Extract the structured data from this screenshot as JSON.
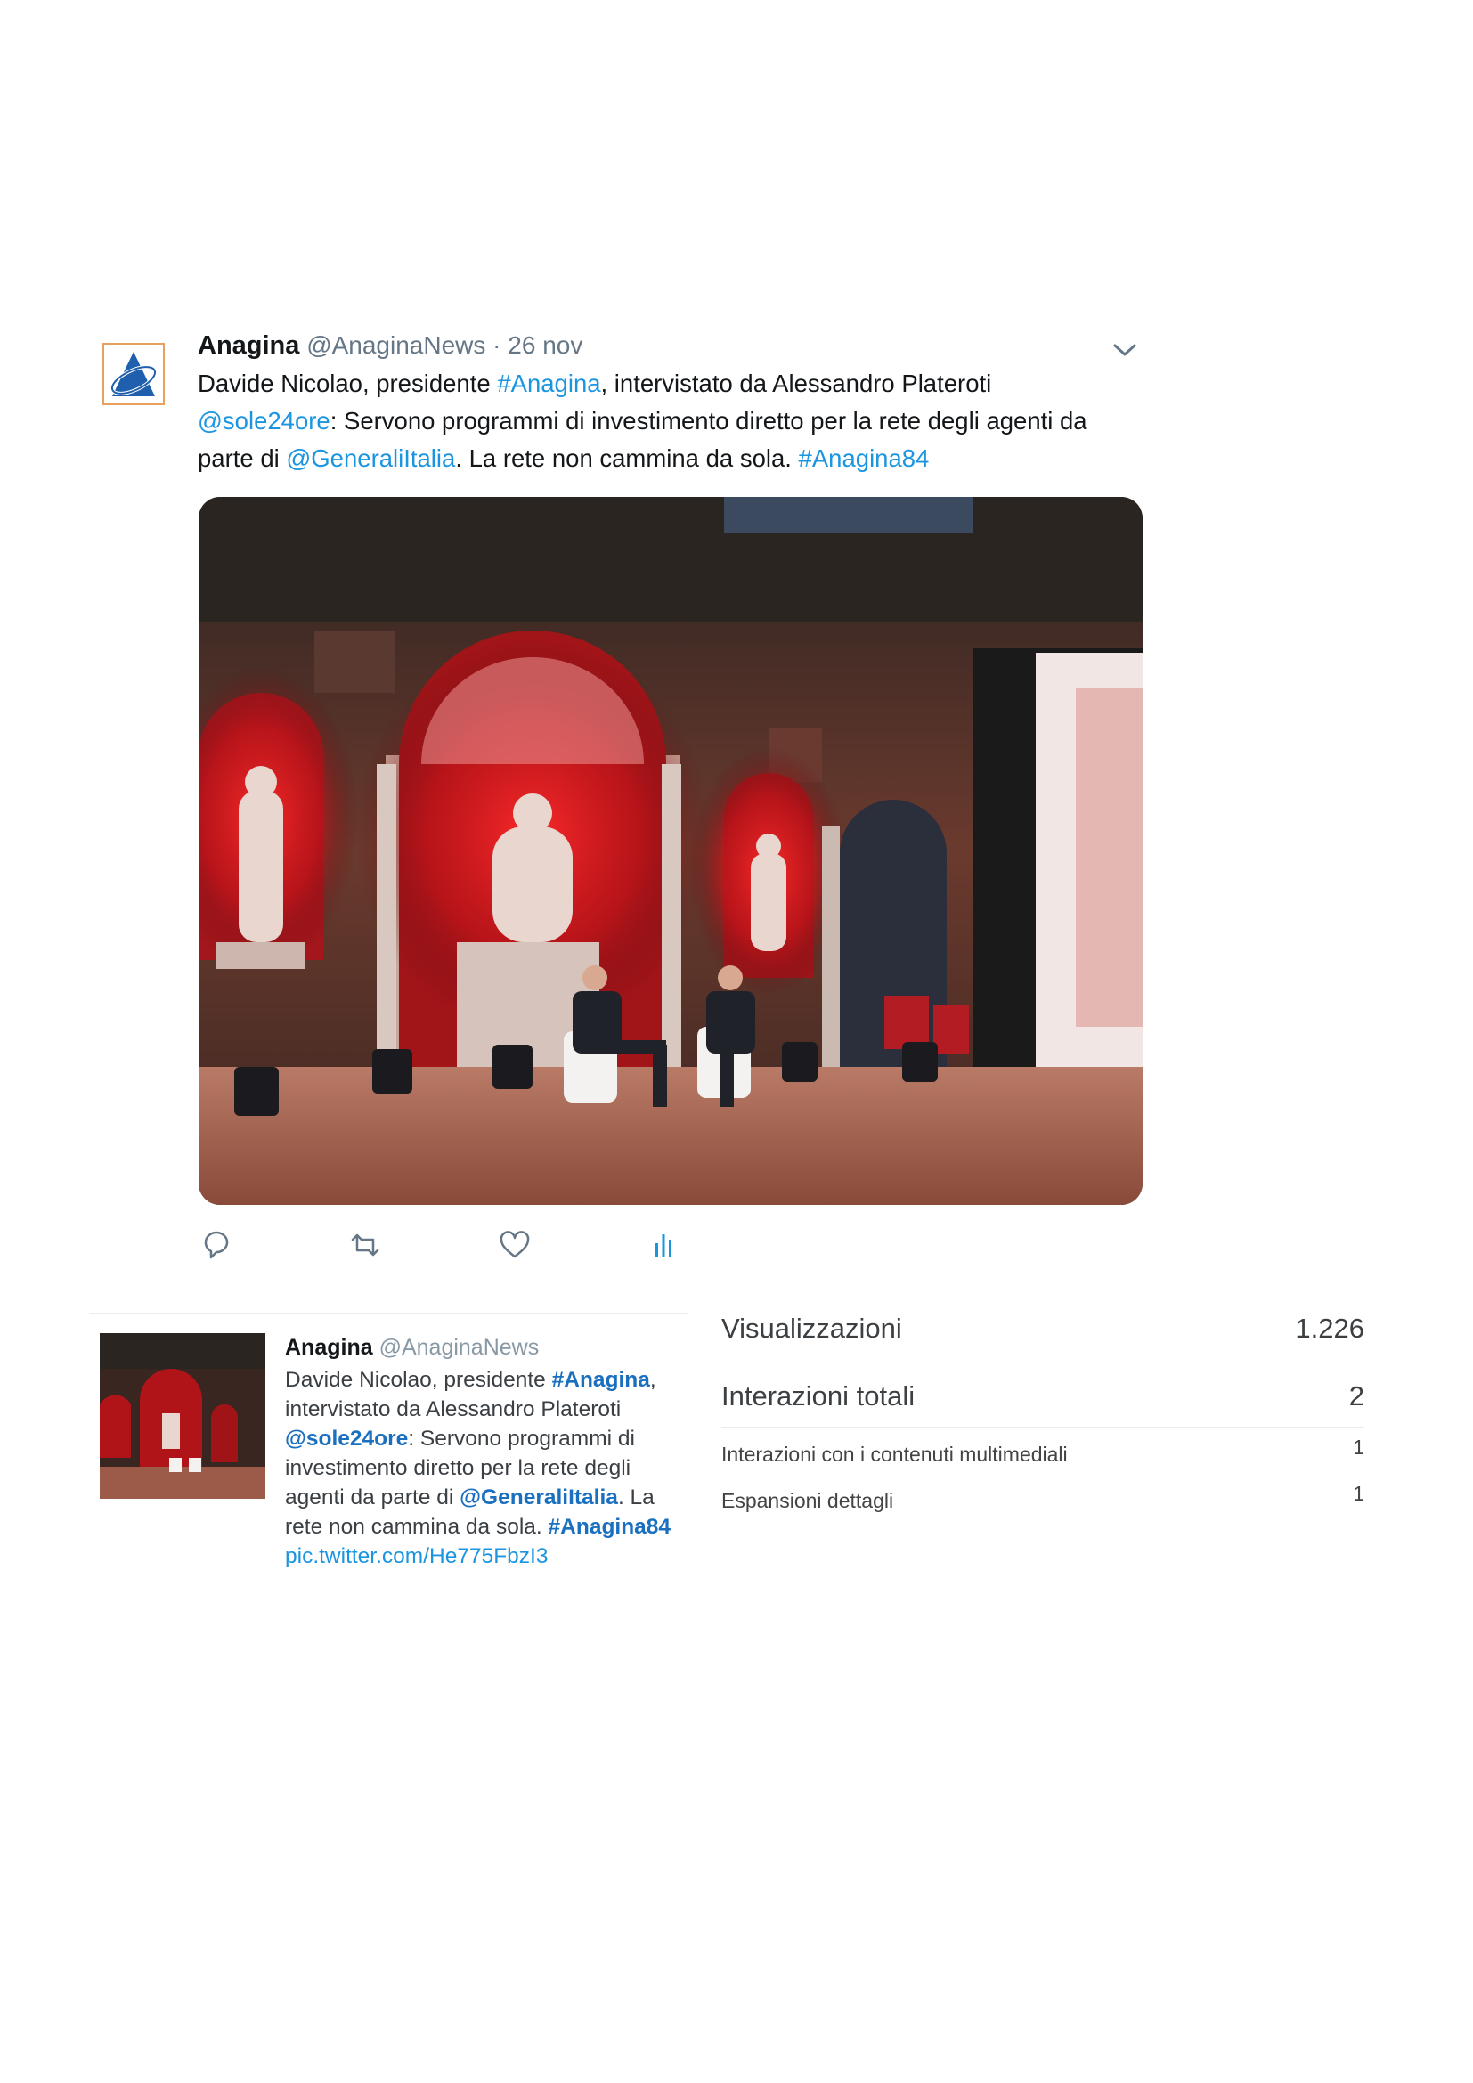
{
  "tweet": {
    "author_name": "Anagina",
    "author_handle": "@AnaginaNews",
    "separator": " · ",
    "date": "26 nov",
    "text_runs": [
      {
        "t": "Davide Nicolao, presidente ",
        "k": "text"
      },
      {
        "t": "#Anagina",
        "k": "link"
      },
      {
        "t": ", intervistato da Alessandro Plateroti ",
        "k": "text"
      },
      {
        "t": "@sole24ore",
        "k": "link"
      },
      {
        "t": ": Servono programmi di investimento diretto per la rete degli agenti da parte di ",
        "k": "text"
      },
      {
        "t": "@GeneraliItalia",
        "k": "link"
      },
      {
        "t": ". La rete non cammina da sola. ",
        "k": "text"
      },
      {
        "t": "#Anagina84",
        "k": "link"
      }
    ],
    "actions": [
      {
        "icon": "reply-icon"
      },
      {
        "icon": "retweet-icon"
      },
      {
        "icon": "like-icon"
      },
      {
        "icon": "analytics-icon"
      }
    ],
    "colors": {
      "link": "#1b95e0",
      "text": "#14171a",
      "meta": "#657786"
    }
  },
  "summary": {
    "author_name": "Anagina",
    "author_handle": "@AnaginaNews",
    "text_runs": [
      {
        "t": "Davide Nicolao, presidente ",
        "k": "text"
      },
      {
        "t": "#Anagina",
        "k": "bold"
      },
      {
        "t": ", intervistato da Alessandro Plateroti ",
        "k": "text"
      },
      {
        "t": "@sole24ore",
        "k": "bold"
      },
      {
        "t": ": Servono programmi di investimento diretto per la rete degli agenti da parte di ",
        "k": "text"
      },
      {
        "t": "@GeneraliItalia",
        "k": "bold"
      },
      {
        "t": ". La rete non cammina da sola. ",
        "k": "text"
      },
      {
        "t": "#Anagina84",
        "k": "bold"
      },
      {
        "t": " ",
        "k": "text"
      },
      {
        "t": "pic.twitter.com/He775FbzI3",
        "k": "link"
      }
    ]
  },
  "metrics": {
    "impressions_label": "Visualizzazioni",
    "impressions_value": "1.226",
    "engagements_label": "Interazioni totali",
    "engagements_value": "2",
    "media_engagements_label": "Interazioni con i contenuti multimediali",
    "media_engagements_value": "1",
    "detail_expands_label": "Espansioni dettagli",
    "detail_expands_value": "1"
  }
}
